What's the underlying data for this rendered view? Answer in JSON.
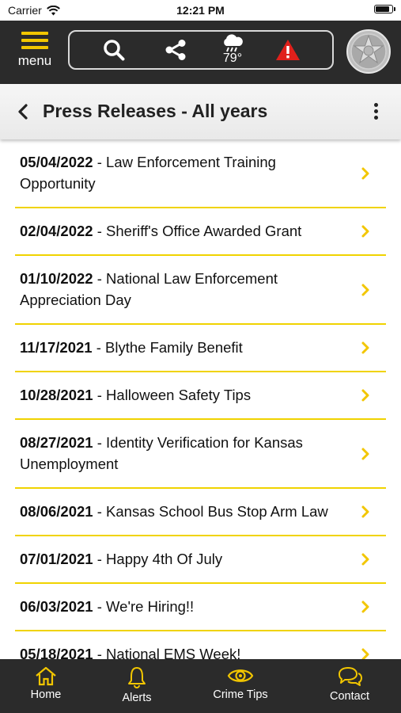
{
  "status_bar": {
    "carrier": "Carrier",
    "time": "12:21 PM",
    "battery_level": 0.9
  },
  "appbar": {
    "menu_label": "menu",
    "weather_temp": "79°"
  },
  "header": {
    "title": "Press Releases - All years"
  },
  "press_releases": [
    {
      "date": "05/04/2022",
      "title": "Law Enforcement Training Opportunity"
    },
    {
      "date": "02/04/2022",
      "title": "Sheriff's Office Awarded Grant"
    },
    {
      "date": "01/10/2022",
      "title": "National Law Enforcement Appreciation Day"
    },
    {
      "date": "11/17/2021",
      "title": "Blythe Family Benefit"
    },
    {
      "date": "10/28/2021",
      "title": "Halloween Safety Tips"
    },
    {
      "date": "08/27/2021",
      "title": "Identity Verification for Kansas Unemployment"
    },
    {
      "date": "08/06/2021",
      "title": "Kansas School Bus Stop Arm Law"
    },
    {
      "date": "07/01/2021",
      "title": "Happy 4th Of July"
    },
    {
      "date": "06/03/2021",
      "title": "We're Hiring!!"
    },
    {
      "date": "05/18/2021",
      "title": "National EMS Week!"
    }
  ],
  "separator": " - ",
  "tabs": [
    {
      "label": "Home",
      "icon": "home-icon"
    },
    {
      "label": "Alerts",
      "icon": "bell-icon"
    },
    {
      "label": "Crime Tips",
      "icon": "eye-icon"
    },
    {
      "label": "Contact",
      "icon": "chat-icon"
    }
  ],
  "colors": {
    "accent": "#f2c600",
    "bar": "#2b2b2b",
    "alert": "#e0201b"
  }
}
